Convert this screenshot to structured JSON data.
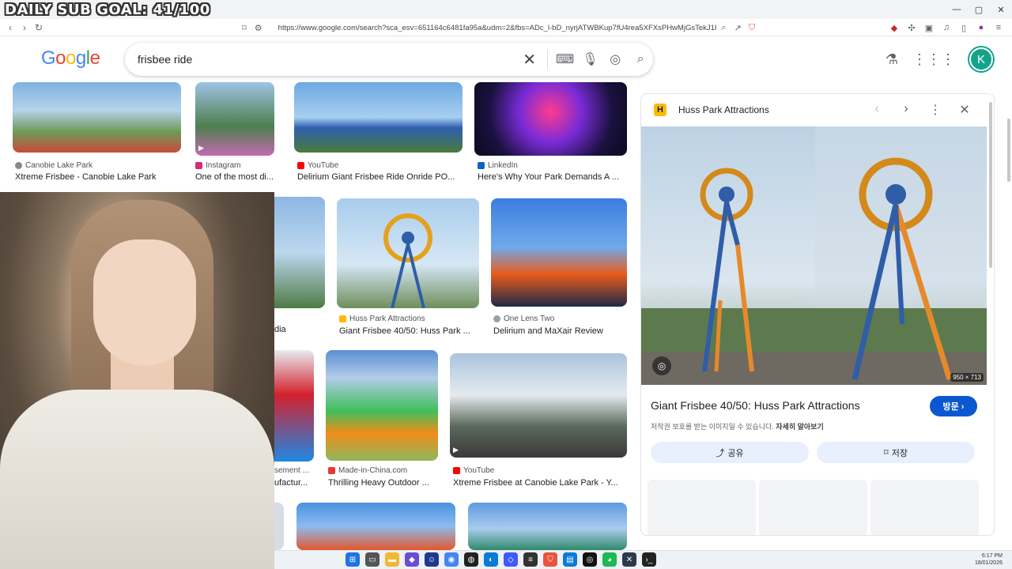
{
  "overlay": {
    "sub_goal": "DAILY SUB GOAL: 41/100"
  },
  "browser": {
    "url": "https://www.google.com/search?sca_esv=651164c6481fa95a&udm=2&fbs=ADc_l-bD_nyrjATWBKup7fU4rea5XFXsPHwMjGsTekJ1HCohLl5jVfW6Wa1g...",
    "window_controls": [
      "—",
      "▢",
      "✕"
    ]
  },
  "google": {
    "logo_letters": [
      "G",
      "o",
      "o",
      "g",
      "l",
      "e"
    ],
    "search_value": "frisbee ride",
    "avatar_letter": "K"
  },
  "results": [
    {
      "source": "Canobie Lake Park",
      "title": "Xtreme Frisbee - Canobie Lake Park",
      "fav_color": "#888888",
      "video": false
    },
    {
      "source": "Instagram",
      "title": "One of the most di...",
      "fav_color": "#d62976",
      "video": true
    },
    {
      "source": "YouTube",
      "title": "Delirium Giant Frisbee Ride Onride PO...",
      "fav_color": "#ff0000",
      "video": false
    },
    {
      "source": "LinkedIn",
      "title": "Here's Why Your Park Demands A ...",
      "fav_color": "#0a66c2",
      "video": false
    },
    {
      "source": "",
      "title": "dia",
      "fav_color": "#999999",
      "video": false
    },
    {
      "source": "Huss Park Attractions",
      "title": "Giant Frisbee 40/50: Huss Park ...",
      "fav_color": "#fbbc05",
      "video": false
    },
    {
      "source": "One Lens Two",
      "title": "Delirium and MaXair Review",
      "fav_color": "#9aa0a6",
      "video": false
    },
    {
      "source": "sement ...",
      "title": "ufactur...",
      "fav_color": "#999999",
      "video": false
    },
    {
      "source": "Made-in-China.com",
      "title": "Thrilling Heavy Outdoor ...",
      "fav_color": "#e53935",
      "video": false
    },
    {
      "source": "YouTube",
      "title": "Xtreme Frisbee at Canobie Lake Park - Y...",
      "fav_color": "#ff0000",
      "video": true
    }
  ],
  "panel": {
    "source": "Huss Park Attractions",
    "favicon_letter": "H",
    "dimensions": "950 × 713",
    "title": "Giant Frisbee 40/50: Huss Park Attractions",
    "visit_label": "방문 ›",
    "copyright": "저작권 보호를 받는 이미지일 수 있습니다.",
    "learn_more": "자세히 알아보기",
    "share_label": "공유",
    "save_label": "저장"
  },
  "taskbar": {
    "time": "6:17 PM",
    "date": "18/01/2026"
  }
}
